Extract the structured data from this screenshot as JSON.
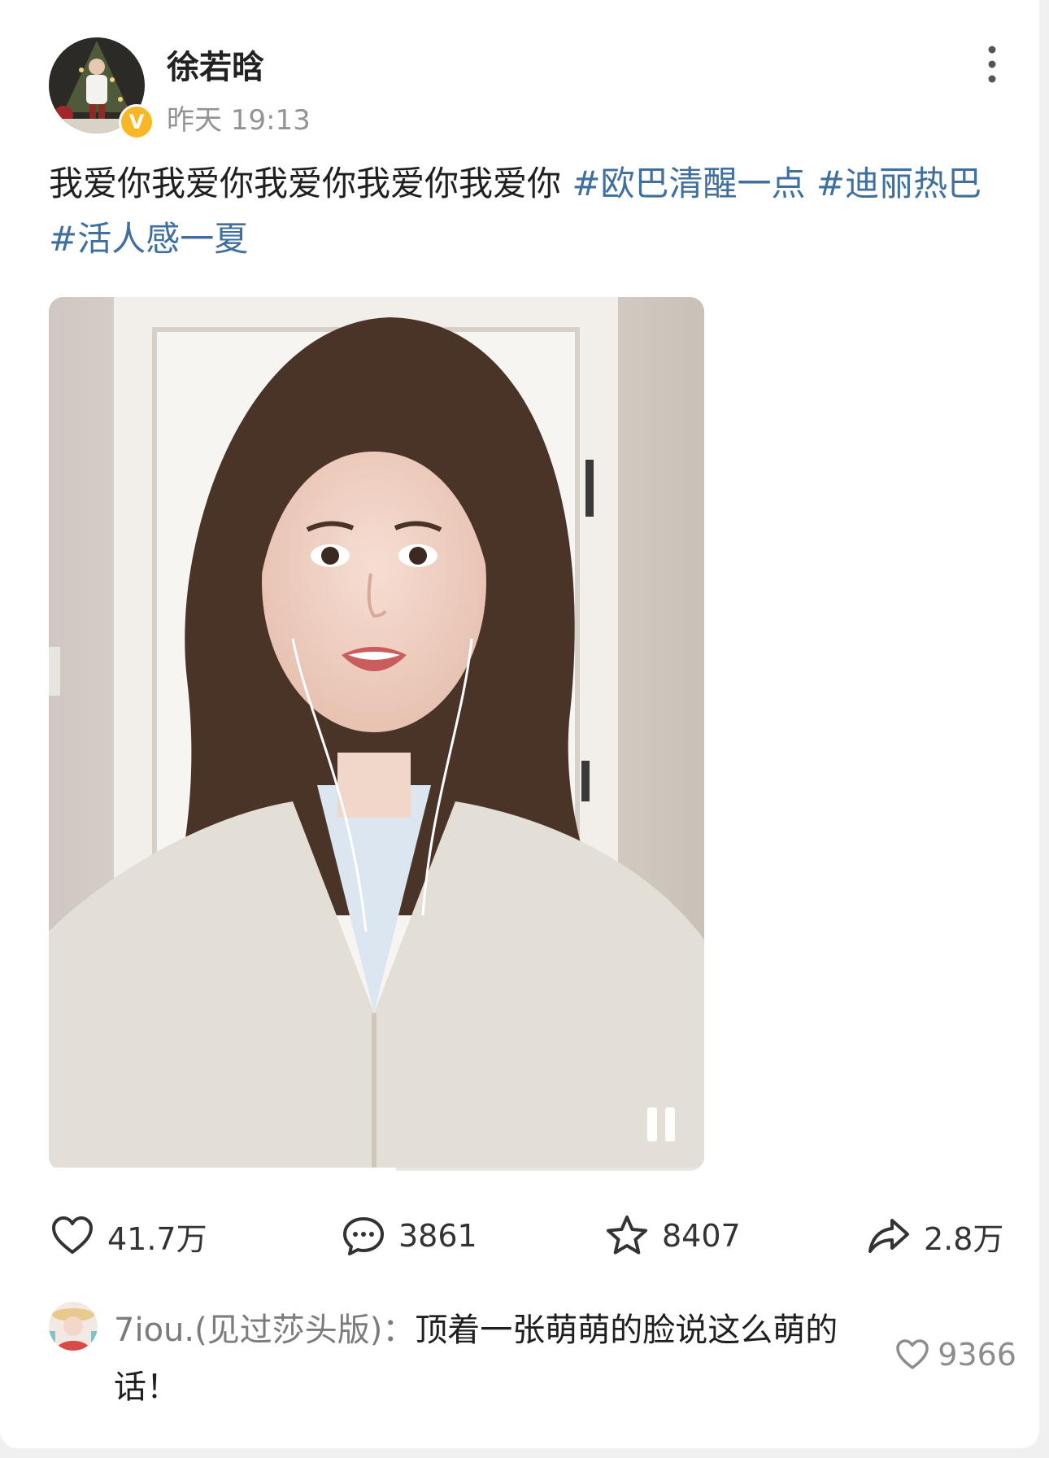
{
  "post": {
    "username": "徐若晗",
    "time": "昨天 19:13",
    "verified_badge": "V",
    "text_plain": "我爱你我爱你我爱你我爱你我爱你 ",
    "tags": [
      "#欧巴清醒一点",
      "#迪丽热巴",
      "#活人感一夏"
    ],
    "video": {
      "progress": 0.53,
      "state": "playing",
      "control_icon": "pause-icon"
    }
  },
  "actions": {
    "like_count": "41.7万",
    "comment_count": "3861",
    "favorite_count": "8407",
    "share_count": "2.8万"
  },
  "comment": {
    "author": "7iou.(见过莎头版)：",
    "text": "顶着一张萌萌的脸说这么萌的话！",
    "like_count": "9366"
  },
  "colors": {
    "tag": "#3f6f9e",
    "text": "#1f1f1f",
    "muted": "#939393",
    "verified": "#f8b826"
  }
}
